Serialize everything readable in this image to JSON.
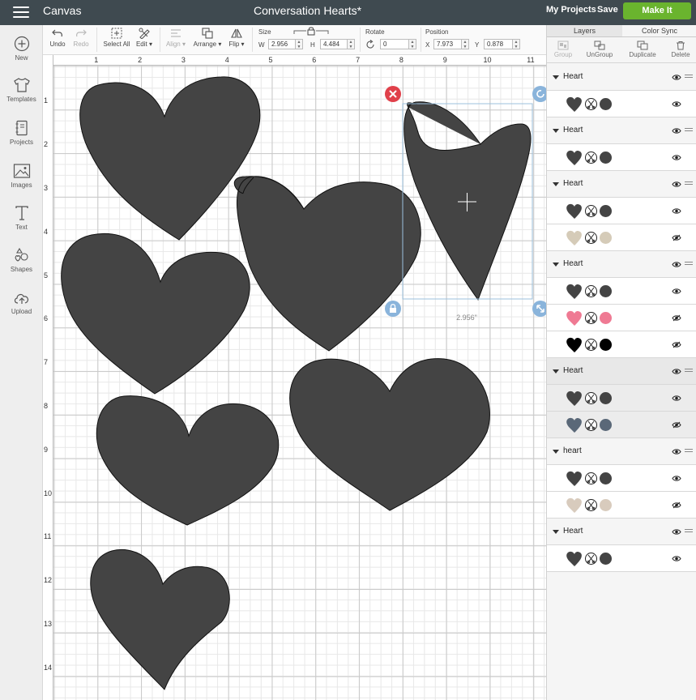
{
  "topbar": {
    "app_title": "Canvas",
    "doc_title": "Conversation Hearts*",
    "my_projects": "My Projects",
    "save": "Save",
    "make_it": "Make It"
  },
  "leftnav": [
    {
      "label": "New",
      "icon": "plus-circle-icon"
    },
    {
      "label": "Templates",
      "icon": "shirt-icon"
    },
    {
      "label": "Projects",
      "icon": "notebook-icon"
    },
    {
      "label": "Images",
      "icon": "image-icon"
    },
    {
      "label": "Text",
      "icon": "text-icon"
    },
    {
      "label": "Shapes",
      "icon": "shapes-icon"
    },
    {
      "label": "Upload",
      "icon": "cloud-upload-icon"
    }
  ],
  "toolbar": {
    "undo": "Undo",
    "redo": "Redo",
    "select_all": "Select All",
    "edit": "Edit",
    "align": "Align",
    "arrange": "Arrange",
    "flip": "Flip",
    "size_label": "Size",
    "w_label": "W",
    "w_value": "2.956",
    "h_label": "H",
    "h_value": "4.484",
    "rotate_label": "Rotate",
    "rotate_value": "0",
    "position_label": "Position",
    "x_label": "X",
    "x_value": "7.973",
    "y_label": "Y",
    "y_value": "0.878"
  },
  "canvas": {
    "ruler_top": [
      "1",
      "2",
      "3",
      "4",
      "5",
      "6",
      "7",
      "8",
      "9",
      "10",
      "11"
    ],
    "ruler_left": [
      "1",
      "2",
      "3",
      "4",
      "5",
      "6",
      "7",
      "8",
      "9",
      "10",
      "11",
      "12",
      "13",
      "14"
    ],
    "selection_width_label": "2.956\"",
    "shape_color": "#444444"
  },
  "panel": {
    "tab_layers": "Layers",
    "tab_color_sync": "Color Sync",
    "actions": {
      "group": "Group",
      "ungroup": "UnGroup",
      "duplicate": "Duplicate",
      "delete": "Delete"
    },
    "groups": [
      {
        "name": "Heart",
        "items": [
          {
            "color": "#444444",
            "visible": true
          }
        ]
      },
      {
        "name": "Heart",
        "items": [
          {
            "color": "#444444",
            "visible": true
          }
        ]
      },
      {
        "name": "Heart",
        "items": [
          {
            "color": "#444444",
            "visible": true
          },
          {
            "color": "#d5cbb8",
            "visible": false
          }
        ]
      },
      {
        "name": "Heart",
        "items": [
          {
            "color": "#444444",
            "visible": true
          },
          {
            "color": "#ef7a93",
            "visible": false
          },
          {
            "color": "#000000",
            "visible": false
          }
        ]
      },
      {
        "name": "Heart",
        "selected": true,
        "items": [
          {
            "color": "#444444",
            "visible": true
          },
          {
            "color": "#5a6878",
            "visible": false
          }
        ]
      },
      {
        "name": "heart",
        "items": [
          {
            "color": "#444444",
            "visible": true
          },
          {
            "color": "#d8cbbd",
            "visible": false
          }
        ]
      },
      {
        "name": "Heart",
        "items": [
          {
            "color": "#444444",
            "visible": true
          }
        ]
      }
    ]
  }
}
